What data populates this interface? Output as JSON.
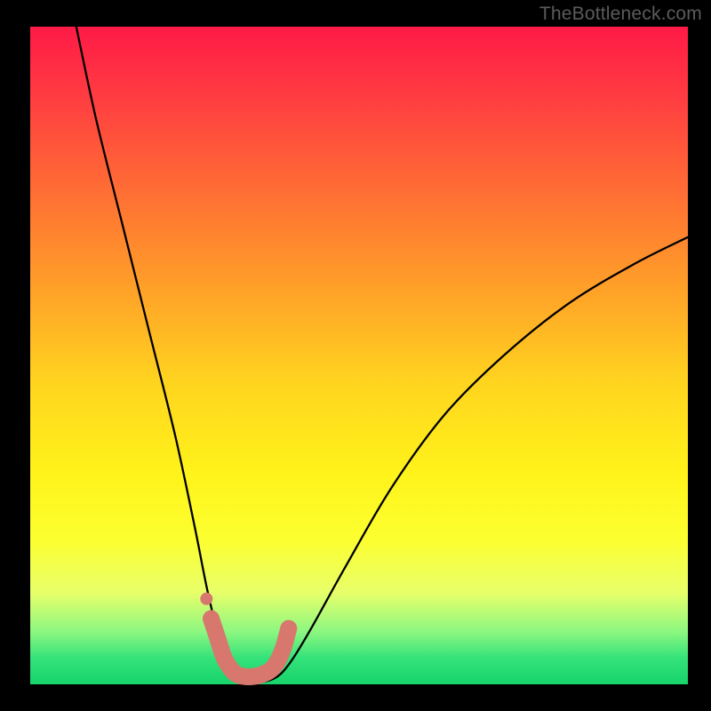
{
  "watermark": "TheBottleneck.com",
  "chart_data": {
    "type": "line",
    "title": "",
    "xlabel": "",
    "ylabel": "",
    "xlim": [
      0,
      100
    ],
    "ylim": [
      0,
      100
    ],
    "grid": false,
    "background": {
      "type": "vertical-gradient",
      "stops": [
        {
          "pos": 0,
          "color": "#ff1a46"
        },
        {
          "pos": 24,
          "color": "#ff6a35"
        },
        {
          "pos": 54,
          "color": "#ffd41f"
        },
        {
          "pos": 78,
          "color": "#fcff30"
        },
        {
          "pos": 92,
          "color": "#8cf780"
        },
        {
          "pos": 100,
          "color": "#17d46b"
        }
      ]
    },
    "series": [
      {
        "name": "bottleneck-curve",
        "color": "#000000",
        "x": [
          7,
          10,
          14,
          18,
          22,
          25,
          27,
          29,
          30.5,
          32,
          34,
          36,
          38,
          40,
          43,
          48,
          55,
          63,
          72,
          82,
          92,
          100
        ],
        "values": [
          100,
          86,
          70,
          54,
          38,
          24,
          14,
          6,
          2,
          0.5,
          0.3,
          0.5,
          1.5,
          4,
          9,
          18,
          30,
          41,
          50,
          58,
          64,
          68
        ]
      },
      {
        "name": "marker-band",
        "type": "scatter",
        "color": "#d8776d",
        "x": [
          27.5,
          28.5,
          29.5,
          31,
          32.5,
          34,
          35.5,
          37,
          38.3,
          39.3
        ],
        "values": [
          10,
          7,
          4,
          1.8,
          1.2,
          1.2,
          1.6,
          2.6,
          5,
          8.5
        ]
      },
      {
        "name": "marker-isolated",
        "type": "scatter",
        "color": "#d8776d",
        "x": [
          26.8
        ],
        "values": [
          13
        ]
      }
    ]
  }
}
